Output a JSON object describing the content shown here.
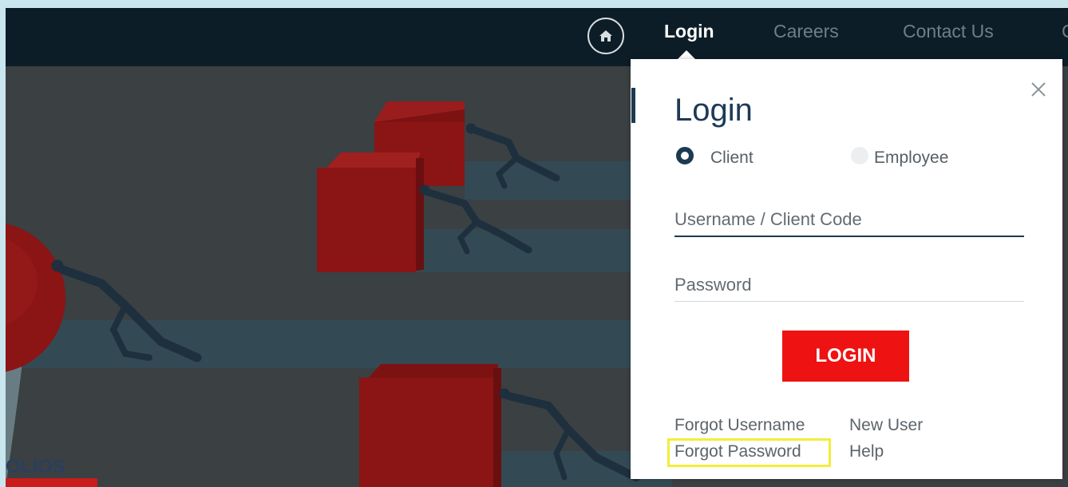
{
  "nav": {
    "home_icon": "home-icon",
    "items": [
      {
        "label": "Login",
        "active": true
      },
      {
        "label": "Careers",
        "active": false
      },
      {
        "label": "Contact Us",
        "active": false
      },
      {
        "label": "C",
        "active": false
      }
    ]
  },
  "hero": {
    "section_label": "OLIOS"
  },
  "login": {
    "title": "Login",
    "close_icon": "close-icon",
    "user_types": [
      {
        "label": "Client",
        "selected": true
      },
      {
        "label": "Employee",
        "selected": false
      }
    ],
    "username_placeholder": "Username / Client Code",
    "username_value": "",
    "password_placeholder": "Password",
    "password_value": "",
    "submit_label": "LOGIN",
    "links": {
      "forgot_username": "Forgot Username",
      "new_user": "New User",
      "forgot_password": "Forgot Password",
      "help": "Help"
    }
  },
  "colors": {
    "nav_bg": "#0c1d28",
    "accent_navy": "#1b3a52",
    "login_button": "#ee1212",
    "highlight": "#f2ee3a",
    "cube_red": "#8b1414"
  }
}
